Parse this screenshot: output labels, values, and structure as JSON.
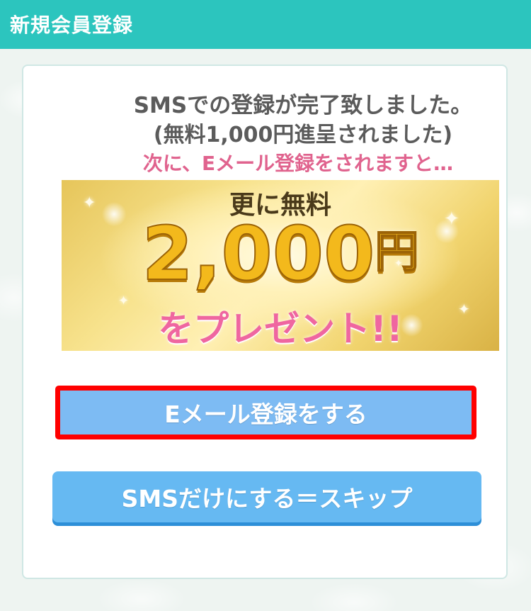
{
  "header": {
    "title": "新規会員登録"
  },
  "message": {
    "line1": "SMSでの登録が完了致しました。",
    "line2": "(無料1,000円進呈されました)",
    "line3": "次に、Eメール登録をされますと…"
  },
  "banner": {
    "top": "更に無料",
    "amount": "2,000",
    "unit": "円",
    "bottom": "をプレゼント!!"
  },
  "buttons": {
    "email_register": "Eメール登録をする",
    "skip": "SMSだけにする＝スキップ"
  },
  "colors": {
    "header": "#2cc5be",
    "email_button": "#7dbbf3",
    "highlight_border": "#ff0000",
    "skip_button": "#66b9f2",
    "pink_text": "#e0638e"
  }
}
